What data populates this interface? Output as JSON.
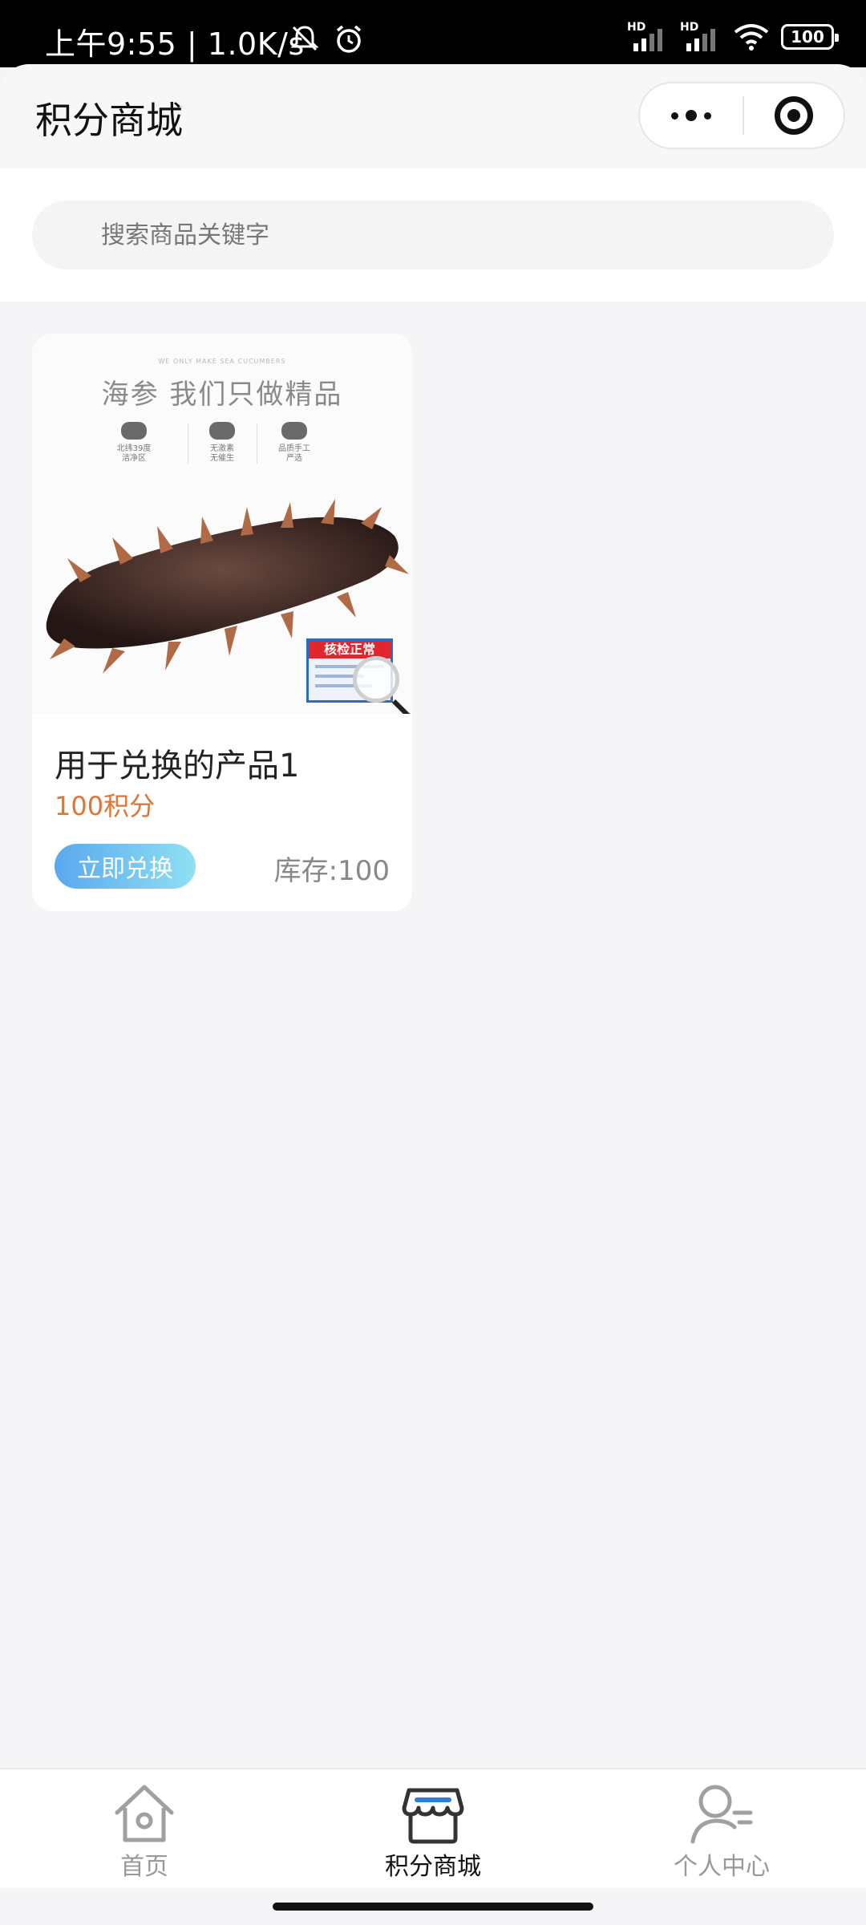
{
  "status_bar": {
    "time": "上午9:55 | 1.0K/s",
    "signal_label": "HD",
    "battery": "100"
  },
  "nav": {
    "title": "积分商城"
  },
  "search": {
    "placeholder": "搜索商品关键字"
  },
  "products": [
    {
      "image": {
        "tagline": "WE ONLY MAKE SEA CUCUMBERS",
        "headline": "海参 我们只做精品",
        "features": [
          {
            "line1": "北纬39度",
            "line2": "洁净区"
          },
          {
            "line1": "无激素",
            "line2": "无催生"
          },
          {
            "line1": "品质手工",
            "line2": "严选"
          }
        ],
        "seal_text": "核检正常"
      },
      "name": "用于兑换的产品1",
      "points": "100积分",
      "redeem_label": "立即兑换",
      "stock": "库存:100"
    }
  ],
  "tabbar": {
    "items": [
      {
        "label": "首页",
        "icon": "home-icon",
        "active": false
      },
      {
        "label": "积分商城",
        "icon": "store-icon",
        "active": true
      },
      {
        "label": "个人中心",
        "icon": "user-icon",
        "active": false
      }
    ]
  },
  "colors": {
    "points": "#e07532",
    "button_gradient_start": "#5aa8ee",
    "button_gradient_end": "#8fe0f2",
    "active_tab_accent": "#2f7fd8"
  }
}
